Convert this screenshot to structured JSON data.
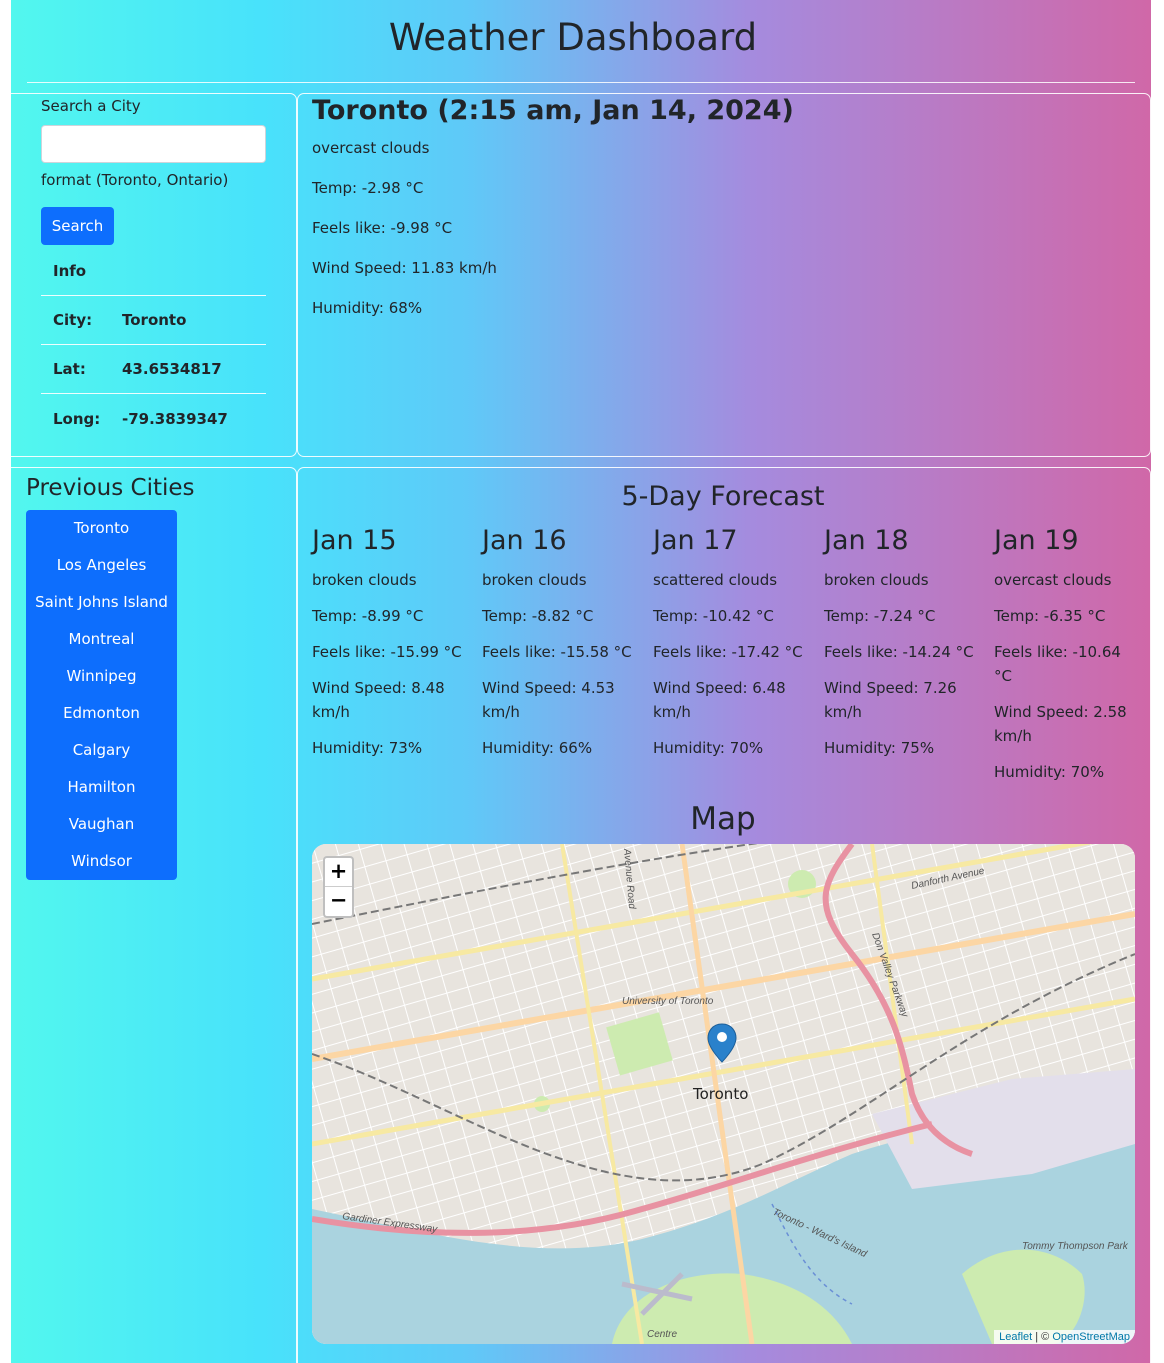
{
  "header": {
    "title": "Weather Dashboard"
  },
  "search": {
    "label": "Search a City",
    "input_value": "",
    "hint": "format (Toronto, Ontario)",
    "button_label": "Search"
  },
  "info": {
    "heading": "Info",
    "rows": [
      {
        "key": "City:",
        "value": "Toronto"
      },
      {
        "key": "Lat:",
        "value": "43.6534817"
      },
      {
        "key": "Long:",
        "value": "-79.3839347"
      }
    ]
  },
  "previous": {
    "title": "Previous Cities",
    "cities": [
      "Toronto",
      "Los Angeles",
      "Saint Johns Island",
      "Montreal",
      "Winnipeg",
      "Edmonton",
      "Calgary",
      "Hamilton",
      "Vaughan",
      "Windsor"
    ]
  },
  "current": {
    "title": "Toronto (2:15 am, Jan 14, 2024)",
    "description": "overcast clouds",
    "temp": "Temp: -2.98 °C",
    "feels": "Feels like: -9.98 °C",
    "wind": "Wind Speed: 11.83 km/h",
    "humidity": "Humidity: 68%"
  },
  "forecast": {
    "title": "5-Day Forecast",
    "days": [
      {
        "date": "Jan 15",
        "desc": "broken clouds",
        "temp": "Temp: -8.99 °C",
        "feels": "Feels like: -15.99 °C",
        "wind": "Wind Speed: 8.48 km/h",
        "humidity": "Humidity: 73%"
      },
      {
        "date": "Jan 16",
        "desc": "broken clouds",
        "temp": "Temp: -8.82 °C",
        "feels": "Feels like: -15.58 °C",
        "wind": "Wind Speed: 4.53 km/h",
        "humidity": "Humidity: 66%"
      },
      {
        "date": "Jan 17",
        "desc": "scattered clouds",
        "temp": "Temp: -10.42 °C",
        "feels": "Feels like: -17.42 °C",
        "wind": "Wind Speed: 6.48 km/h",
        "humidity": "Humidity: 70%"
      },
      {
        "date": "Jan 18",
        "desc": "broken clouds",
        "temp": "Temp: -7.24 °C",
        "feels": "Feels like: -14.24 °C",
        "wind": "Wind Speed: 7.26 km/h",
        "humidity": "Humidity: 75%"
      },
      {
        "date": "Jan 19",
        "desc": "overcast clouds",
        "temp": "Temp: -6.35 °C",
        "feels": "Feels like: -10.64 °C",
        "wind": "Wind Speed: 2.58 km/h",
        "humidity": "Humidity: 70%"
      }
    ]
  },
  "map": {
    "title": "Map",
    "zoom_in": "+",
    "zoom_out": "−",
    "marker_label": "Toronto",
    "attribution_leaflet": "Leaflet",
    "attribution_sep": " | © ",
    "attribution_osm": "OpenStreetMap",
    "street_labels": [
      "Danforth Avenue",
      "Don Valley Parkway",
      "University of Toronto",
      "Gardiner Expressway",
      "Toronto - Ward's Island",
      "Tommy Thompson Park",
      "Centre",
      "Avenue Road"
    ]
  },
  "colors": {
    "button": "#0d6efd",
    "gradient_start": "#52f7ee",
    "gradient_end": "#d068a8",
    "water": "#aad3df",
    "highway": "#e892a2"
  }
}
